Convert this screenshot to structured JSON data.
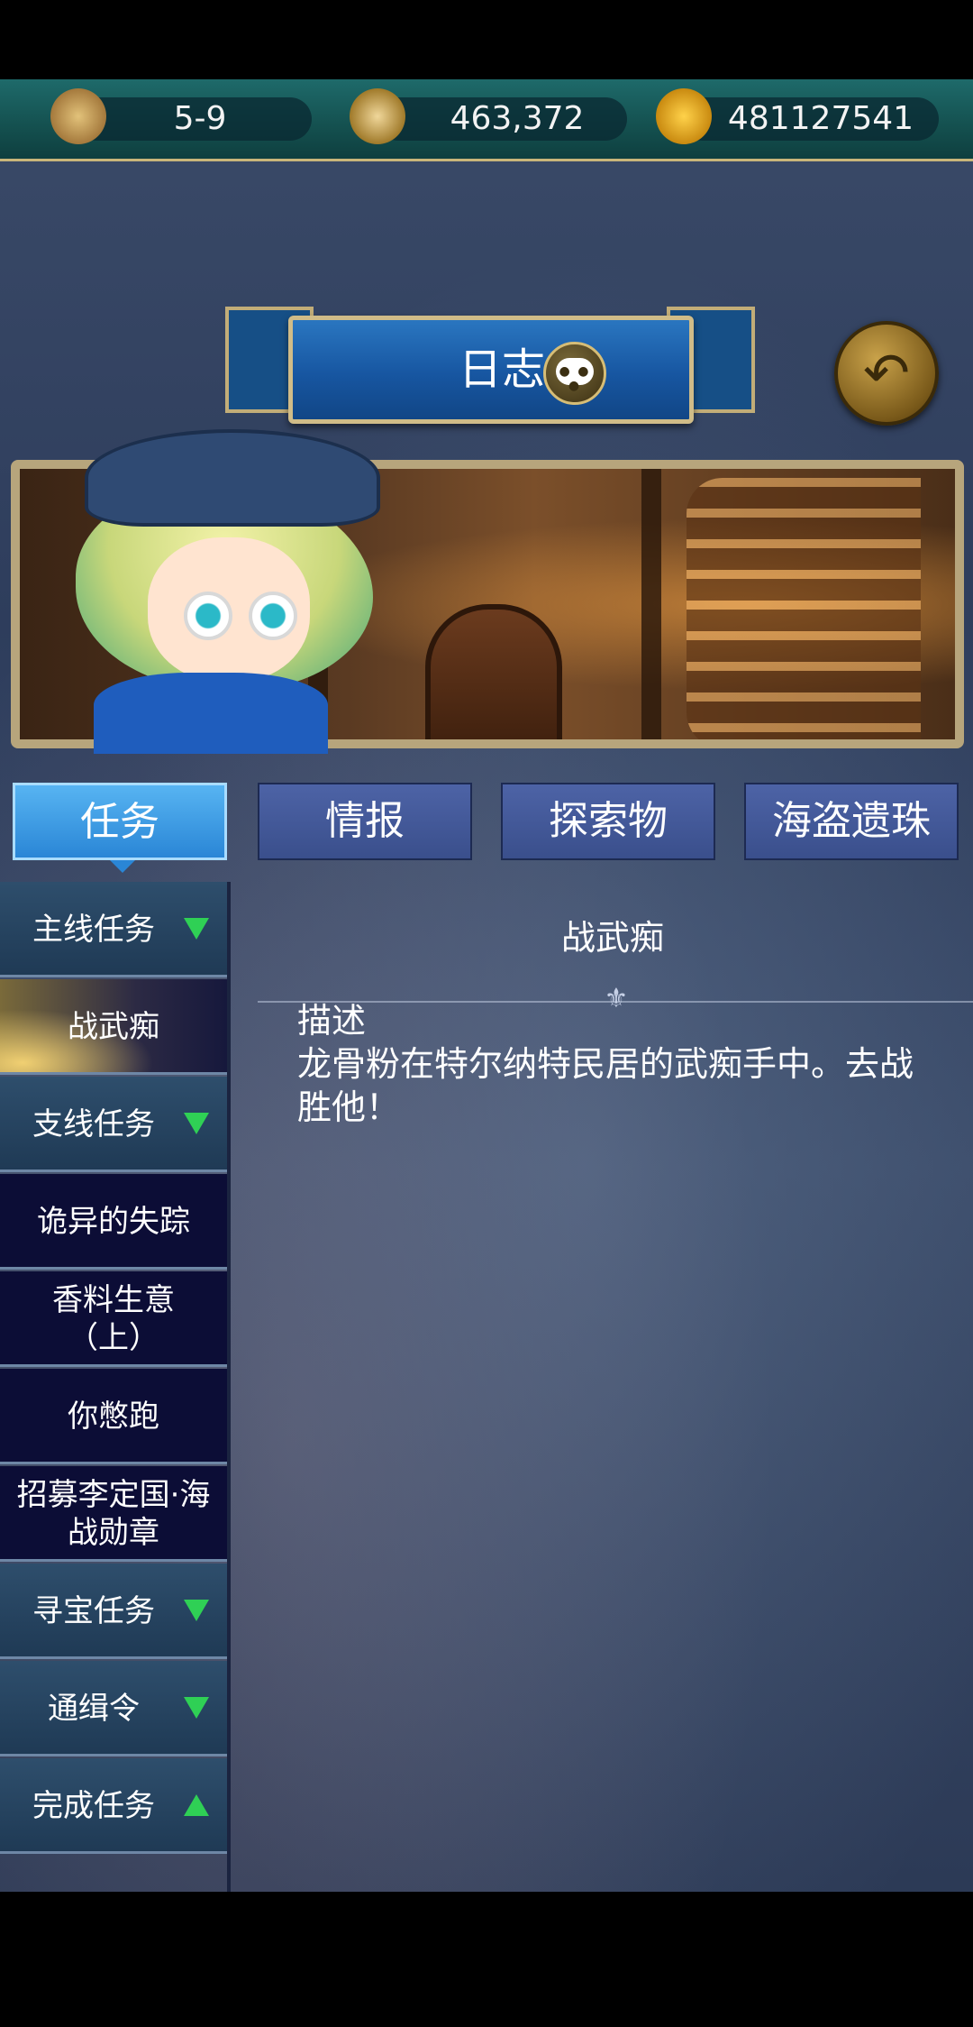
{
  "resources": {
    "stage": "5-9",
    "compass_value": "463,372",
    "gold": "481127541"
  },
  "header": {
    "title": "日志",
    "back_icon": "back-arrow-icon"
  },
  "tabs": [
    {
      "label": "任务",
      "active": true
    },
    {
      "label": "情报",
      "active": false
    },
    {
      "label": "探索物",
      "active": false
    },
    {
      "label": "海盗遗珠",
      "active": false
    }
  ],
  "sidebar": {
    "entries": [
      {
        "type": "category",
        "label": "主线任务",
        "arrow": "down"
      },
      {
        "type": "item",
        "label": "战武痴",
        "selected": true
      },
      {
        "type": "category",
        "label": "支线任务",
        "arrow": "down"
      },
      {
        "type": "item",
        "label": "诡异的失踪"
      },
      {
        "type": "item",
        "label": "香料生意\n（上）"
      },
      {
        "type": "item",
        "label": "你憋跑"
      },
      {
        "type": "item",
        "label": "招募李定国·海\n战勋章"
      },
      {
        "type": "category",
        "label": "寻宝任务",
        "arrow": "down"
      },
      {
        "type": "category",
        "label": "通缉令",
        "arrow": "down"
      },
      {
        "type": "category",
        "label": "完成任务",
        "arrow": "up"
      }
    ]
  },
  "detail": {
    "title": "战武痴",
    "description_label": "描述",
    "description": "龙骨粉在特尔纳特民居的武痴手中。去战胜他！"
  },
  "colors": {
    "accent_green": "#2fd055",
    "tab_active": "#2a86d6",
    "tab_inactive": "#3a4f8c"
  }
}
